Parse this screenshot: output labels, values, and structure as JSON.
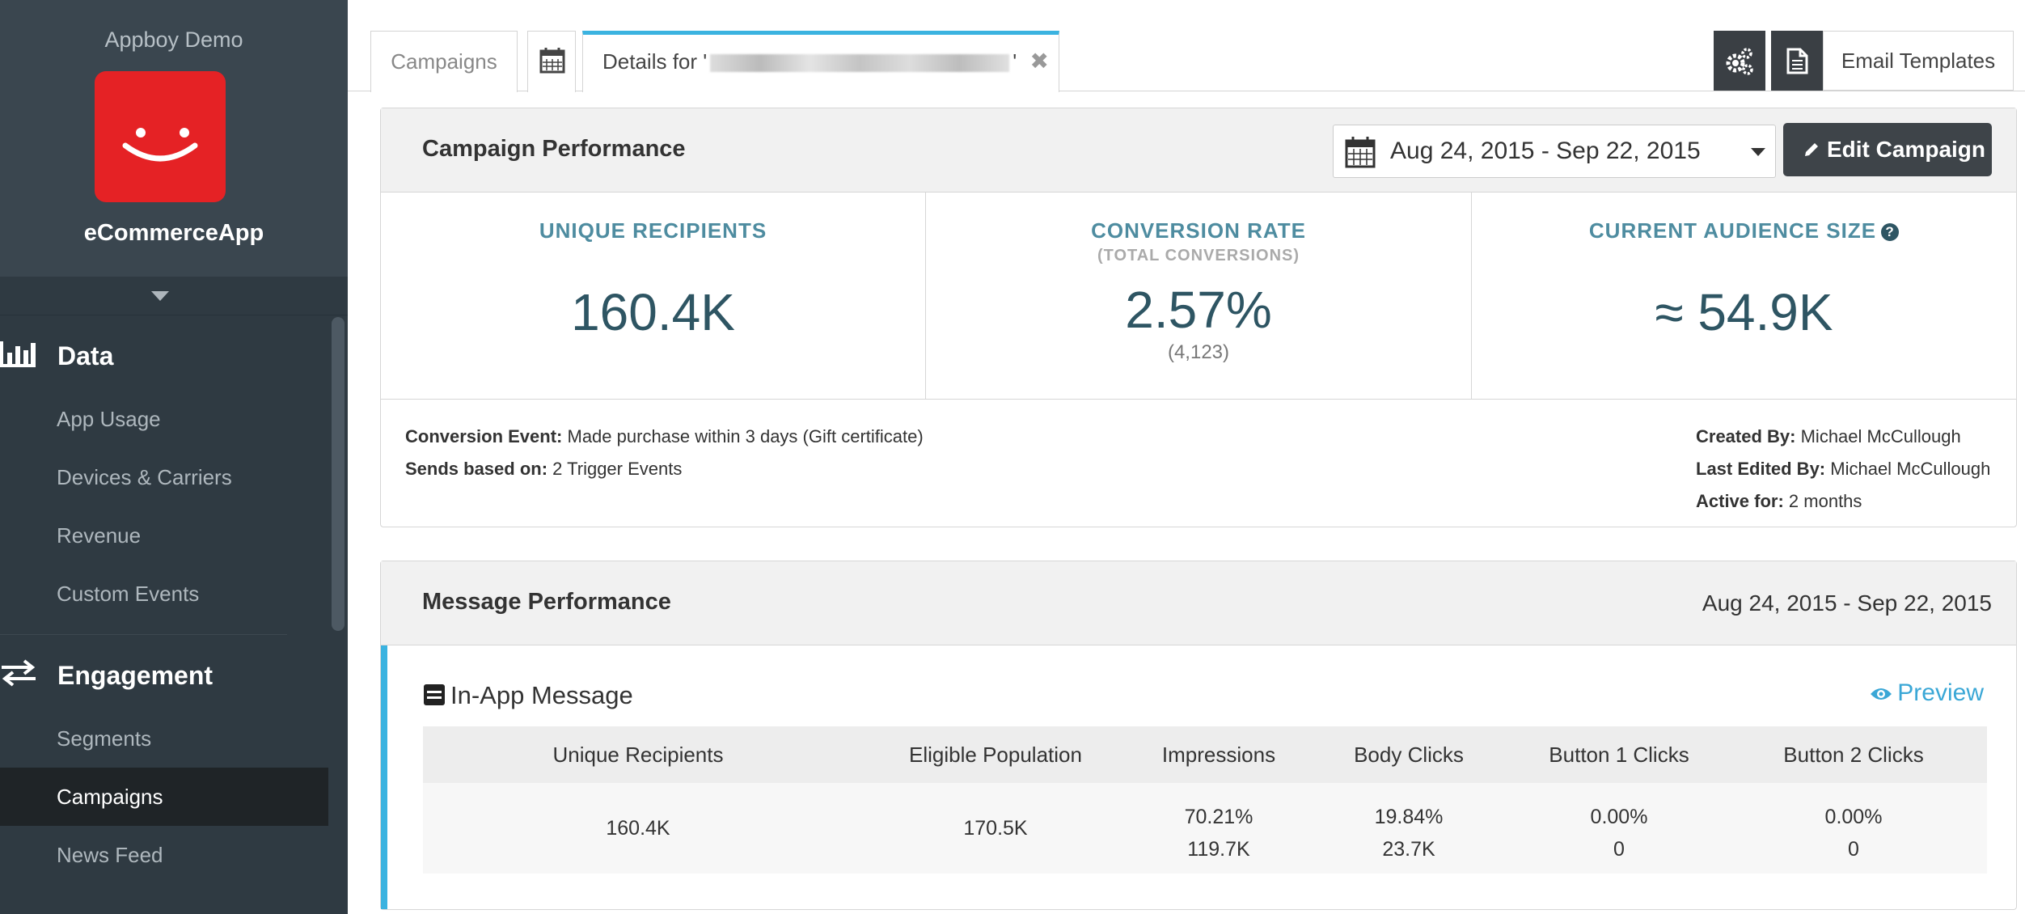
{
  "sidebar": {
    "company": "Appboy Demo",
    "app_name": "eCommerceApp",
    "sections": [
      {
        "label": "Data",
        "icon": "bar-chart-icon",
        "items": [
          "App Usage",
          "Devices & Carriers",
          "Revenue",
          "Custom Events"
        ]
      },
      {
        "label": "Engagement",
        "icon": "exchange-arrows-icon",
        "items": [
          "Segments",
          "Campaigns",
          "News Feed"
        ]
      }
    ],
    "active_item": "Campaigns"
  },
  "tabs": {
    "campaigns": "Campaigns",
    "details_prefix": "Details for '",
    "details_suffix": "'",
    "close": "✖",
    "email_templates": "Email Templates"
  },
  "campaign_performance": {
    "title": "Campaign Performance",
    "date_range": "Aug 24, 2015 - Sep 22, 2015",
    "edit_button": "Edit Campaign",
    "stats": {
      "unique_recipients": {
        "label": "UNIQUE RECIPIENTS",
        "value": "160.4K"
      },
      "conversion_rate": {
        "label": "CONVERSION RATE",
        "sublabel": "(TOTAL CONVERSIONS)",
        "value": "2.57%",
        "count": "(4,123)"
      },
      "audience_size": {
        "label": "CURRENT AUDIENCE SIZE",
        "help": "?",
        "value": "≈ 54.9K"
      }
    },
    "meta": {
      "conversion_event_label": "Conversion Event:",
      "conversion_event": "Made purchase within 3 days (Gift certificate)",
      "sends_based_label": "Sends based on:",
      "sends_based": "2 Trigger Events",
      "created_by_label": "Created By:",
      "created_by": "Michael McCullough",
      "last_edited_label": "Last Edited By:",
      "last_edited": "Michael McCullough",
      "active_for_label": "Active for:",
      "active_for": "2 months"
    }
  },
  "message_performance": {
    "title": "Message Performance",
    "date_range": "Aug 24, 2015 - Sep 22, 2015",
    "message_type": "In-App Message",
    "preview": "Preview",
    "columns": [
      "Unique Recipients",
      "Eligible Population",
      "Impressions",
      "Body Clicks",
      "Button 1 Clicks",
      "Button 2 Clicks"
    ],
    "row": {
      "unique_recipients": "160.4K",
      "eligible_population": "170.5K",
      "impressions_pct": "70.21%",
      "impressions": "119.7K",
      "body_clicks_pct": "19.84%",
      "body_clicks": "23.7K",
      "button1_pct": "0.00%",
      "button1": "0",
      "button2_pct": "0.00%",
      "button2": "0"
    }
  },
  "colors": {
    "accent": "#3bb3e0",
    "logo": "#e52225",
    "sidebar": "#2f3a42",
    "stat_label": "#4e8ca0",
    "stat_value": "#2e5563"
  }
}
